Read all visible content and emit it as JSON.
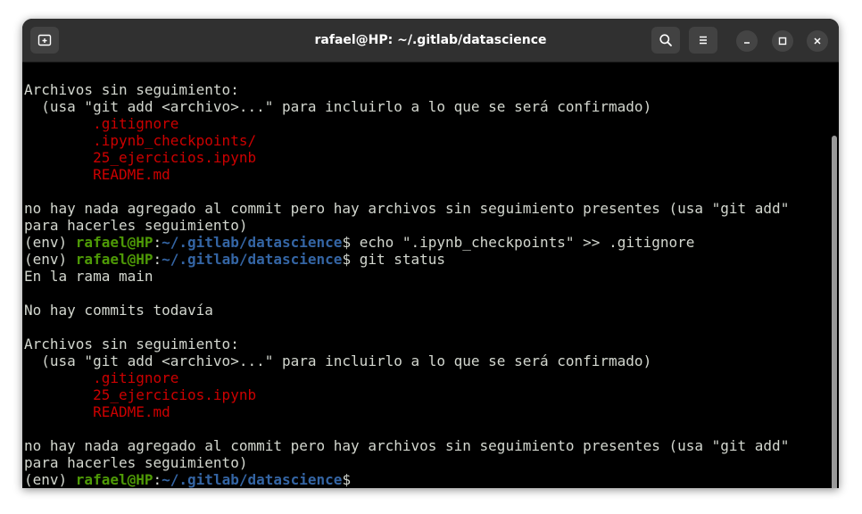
{
  "window": {
    "title": "rafael@HP: ~/.gitlab/datascience"
  },
  "titlebar": {
    "new_tab_icon": "new-tab-icon",
    "search_icon": "search-icon",
    "menu_icon": "hamburger-menu-icon",
    "minimize_icon": "minimize-icon",
    "maximize_icon": "maximize-icon",
    "close_icon": "close-icon"
  },
  "colors": {
    "terminal_bg": "#000000",
    "text": "#d3d7cf",
    "untracked_file": "#cc0000",
    "prompt_user": "#4e9a06",
    "prompt_path": "#3465a4",
    "titlebar_bg": "#303030"
  },
  "prompt": {
    "env": "(env) ",
    "user_host": "rafael@HP",
    "colon": ":",
    "path": "~/.gitlab/datascience",
    "symbol": "$"
  },
  "terminal": {
    "lines": [
      {
        "text": "Archivos sin seguimiento:"
      },
      {
        "text": "  (usa \"git add <archivo>...\" para incluirlo a lo que se será confirmado)"
      },
      {
        "indent": "        ",
        "file": ".gitignore"
      },
      {
        "indent": "        ",
        "file": ".ipynb_checkpoints/"
      },
      {
        "indent": "        ",
        "file": "25_ejercicios.ipynb"
      },
      {
        "indent": "        ",
        "file": "README.md"
      },
      {
        "text": ""
      },
      {
        "text": "no hay nada agregado al commit pero hay archivos sin seguimiento presentes (usa \"git add\""
      },
      {
        "text": "para hacerles seguimiento)"
      },
      {
        "prompt": true,
        "command": " echo \".ipynb_checkpoints\" >> .gitignore"
      },
      {
        "prompt": true,
        "command": " git status"
      },
      {
        "text": "En la rama main"
      },
      {
        "text": ""
      },
      {
        "text": "No hay commits todavía"
      },
      {
        "text": ""
      },
      {
        "text": "Archivos sin seguimiento:"
      },
      {
        "text": "  (usa \"git add <archivo>...\" para incluirlo a lo que se será confirmado)"
      },
      {
        "indent": "        ",
        "file": ".gitignore"
      },
      {
        "indent": "        ",
        "file": "25_ejercicios.ipynb"
      },
      {
        "indent": "        ",
        "file": "README.md"
      },
      {
        "text": ""
      },
      {
        "text": "no hay nada agregado al commit pero hay archivos sin seguimiento presentes (usa \"git add\""
      },
      {
        "text": "para hacerles seguimiento)"
      },
      {
        "prompt": true,
        "command": ""
      }
    ]
  }
}
